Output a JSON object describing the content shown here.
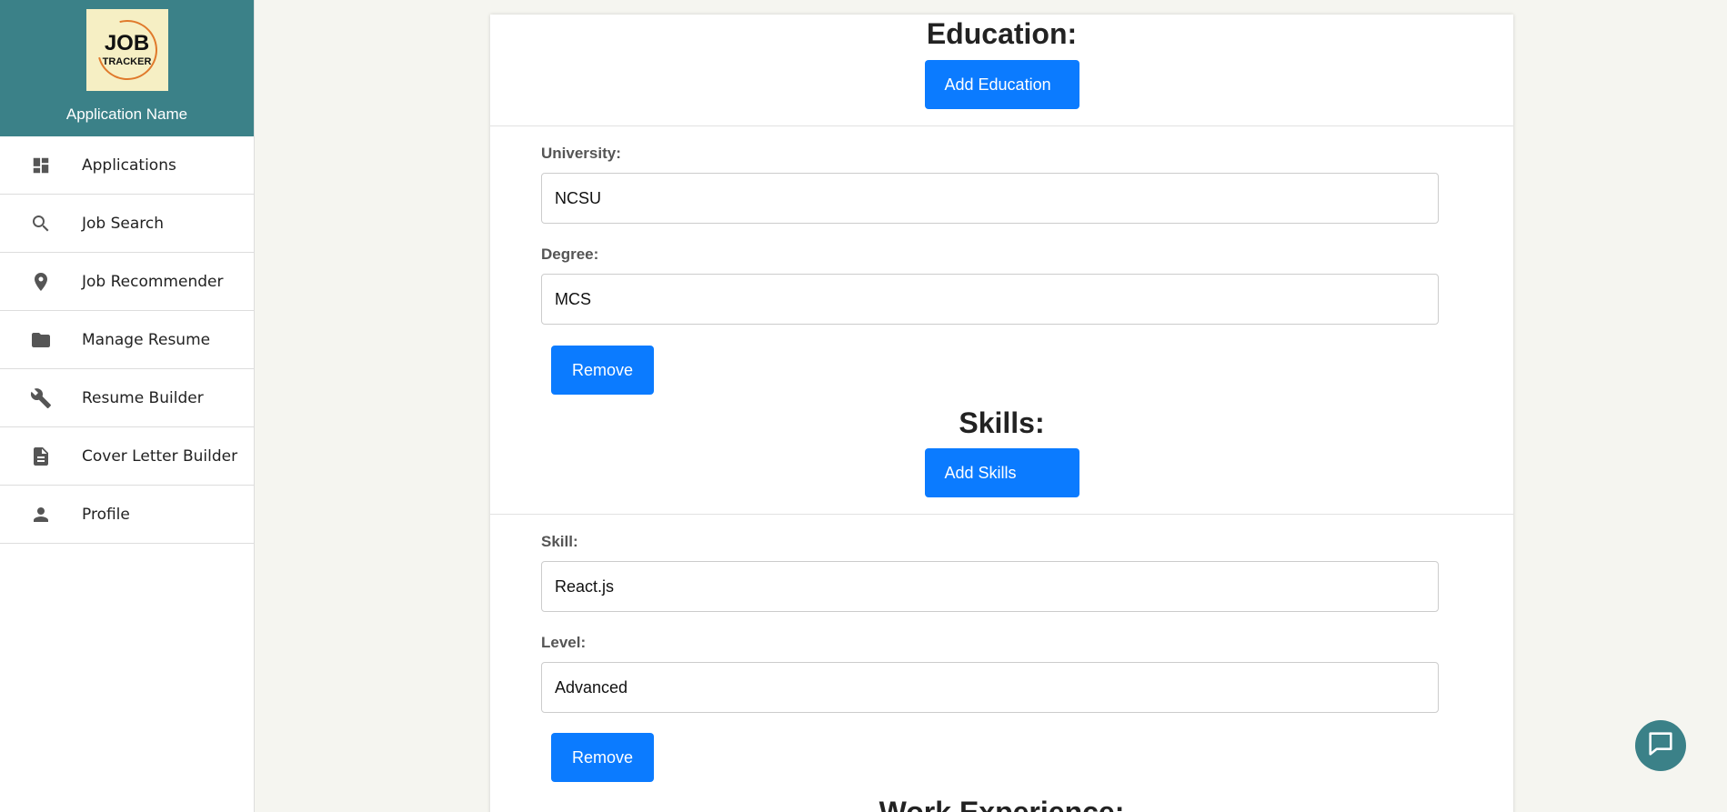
{
  "sidebar": {
    "logo": {
      "line1": "JOB",
      "line2": "TRACKER"
    },
    "app_name": "Application Name",
    "items": [
      {
        "label": "Applications",
        "icon": "dashboard-icon"
      },
      {
        "label": "Job Search",
        "icon": "search-icon"
      },
      {
        "label": "Job Recommender",
        "icon": "location-pin-icon"
      },
      {
        "label": "Manage Resume",
        "icon": "folder-icon"
      },
      {
        "label": "Resume Builder",
        "icon": "wrench-icon"
      },
      {
        "label": "Cover Letter Builder",
        "icon": "document-icon"
      },
      {
        "label": "Profile",
        "icon": "person-icon"
      }
    ]
  },
  "education": {
    "title": "Education:",
    "add_label": "Add Education",
    "university_label": "University:",
    "university_value": "NCSU",
    "degree_label": "Degree:",
    "degree_value": "MCS",
    "remove_label": "Remove"
  },
  "skills": {
    "title": "Skills:",
    "add_label": "Add Skills",
    "skill_label": "Skill:",
    "skill_value": "React.js",
    "level_label": "Level:",
    "level_value": "Advanced",
    "remove_label": "Remove"
  },
  "work": {
    "title": "Work Experience:"
  },
  "colors": {
    "sidebar_header": "#3b8188",
    "primary_button": "#0b7bff",
    "background": "#f5f5f0"
  }
}
